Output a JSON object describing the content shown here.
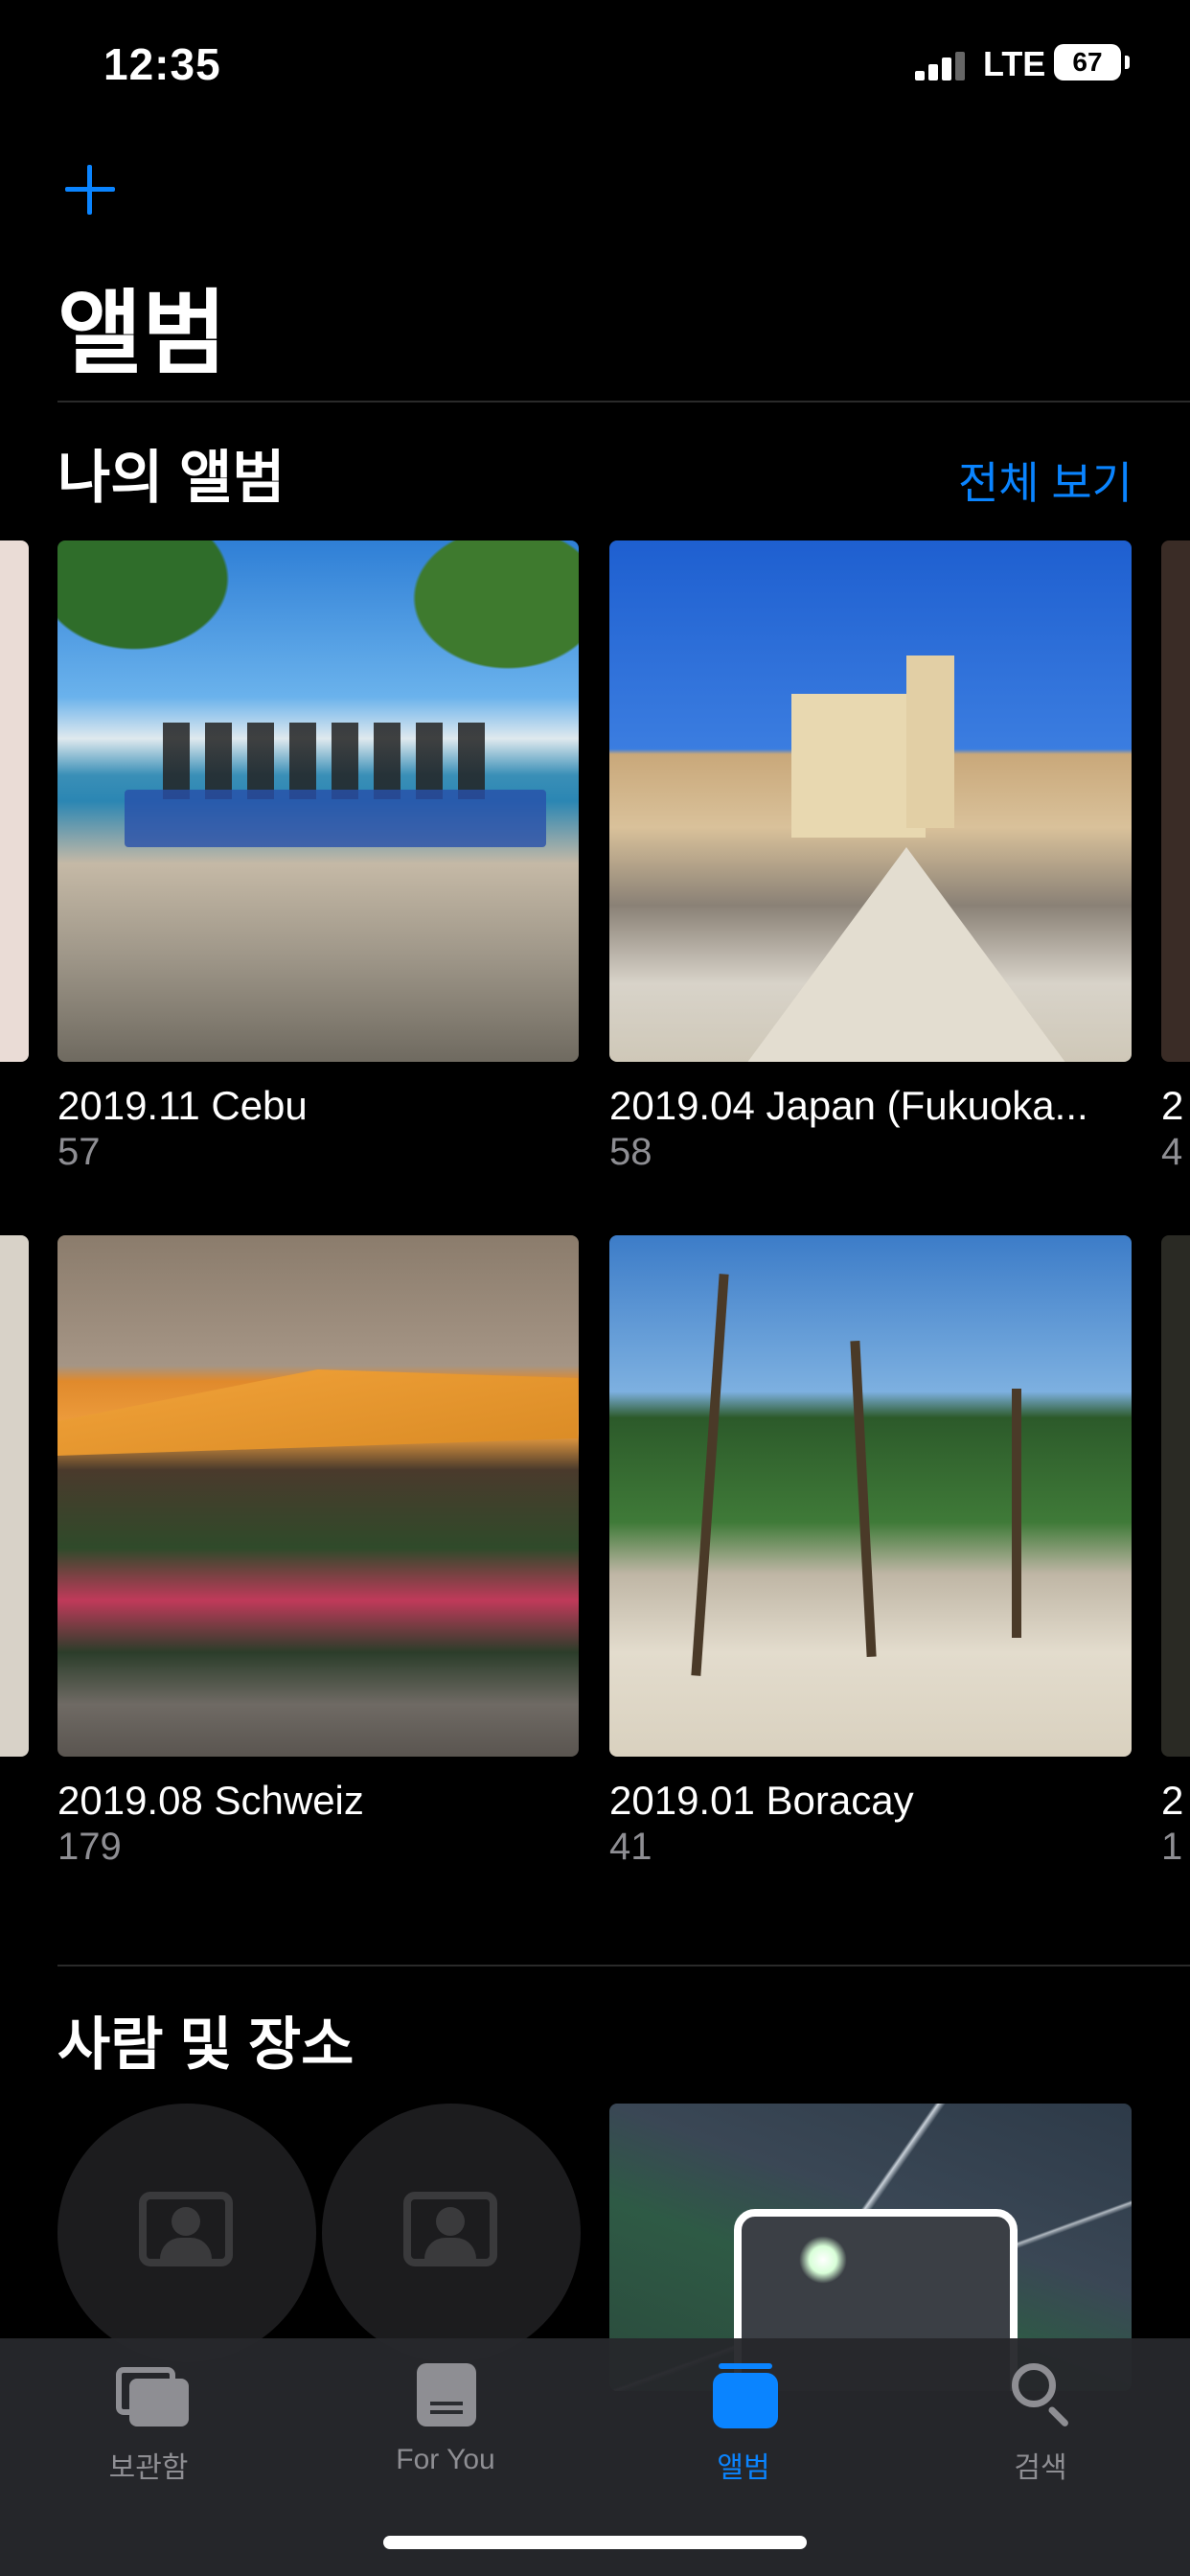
{
  "status_bar": {
    "time": "12:35",
    "network": "LTE",
    "battery": "67"
  },
  "header": {
    "title": "앨범"
  },
  "my_albums": {
    "title": "나의 앨범",
    "see_all": "전체 보기",
    "albums": [
      {
        "name": "2019.11 Cebu",
        "count": "57"
      },
      {
        "name": "2019.04 Japan (Fukuoka...",
        "count": "58"
      },
      {
        "name": "2019.08 Schweiz",
        "count": "179"
      },
      {
        "name": "2019.01 Boracay",
        "count": "41"
      }
    ],
    "peek_right": [
      {
        "name": "2",
        "count": "4"
      },
      {
        "name": "2",
        "count": "1"
      }
    ]
  },
  "people_places": {
    "title": "사람 및 장소"
  },
  "tabs": [
    {
      "label": "보관함",
      "icon": "photo-library-icon",
      "active": false
    },
    {
      "label": "For You",
      "icon": "for-you-icon",
      "active": false
    },
    {
      "label": "앨범",
      "icon": "albums-icon",
      "active": true
    },
    {
      "label": "검색",
      "icon": "search-icon",
      "active": false
    }
  ],
  "colors": {
    "accent": "#0a84ff",
    "background": "#000000",
    "secondary_text": "#8e8e93"
  }
}
